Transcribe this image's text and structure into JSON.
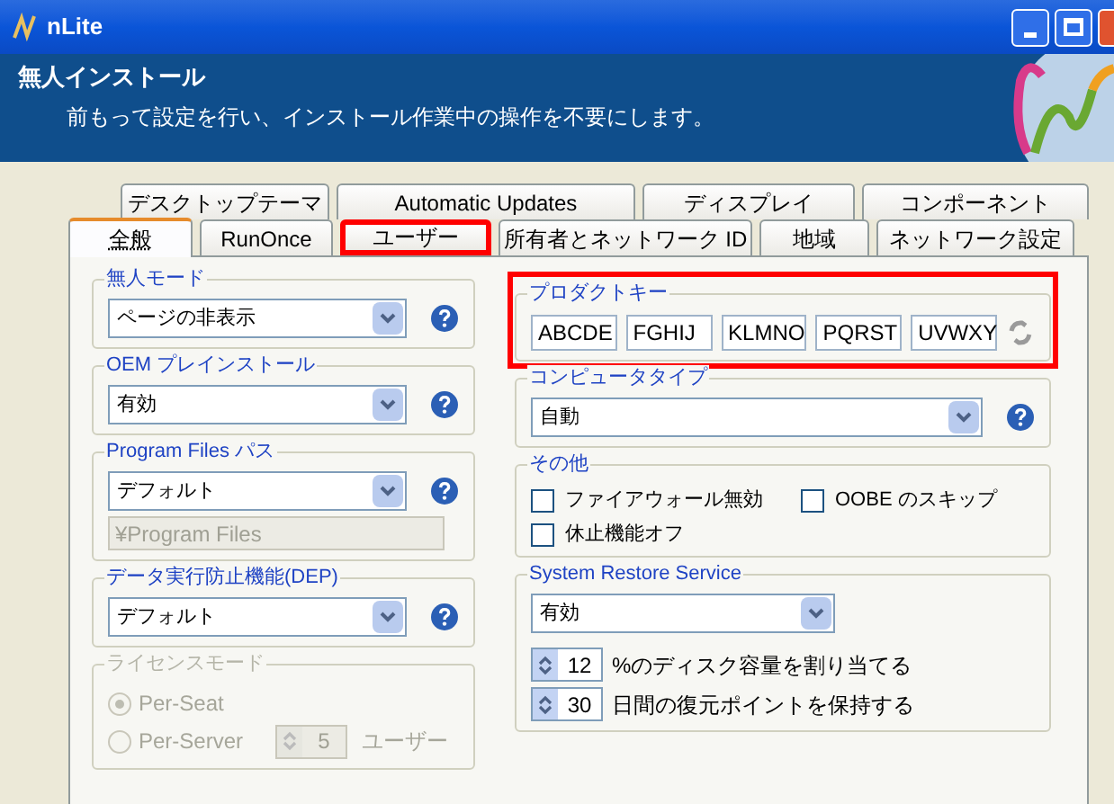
{
  "window": {
    "title": "nLite"
  },
  "header": {
    "title": "無人インストール",
    "subtitle": "前もって設定を行い、インストール作業中の操作を不要にします。"
  },
  "tab_rows": [
    [
      {
        "label": "デスクトップテーマ",
        "selected": false,
        "highlighted": false
      },
      {
        "label": "Automatic Updates",
        "selected": false,
        "highlighted": false
      },
      {
        "label": "ディスプレイ",
        "selected": false,
        "highlighted": false
      },
      {
        "label": "コンポーネント",
        "selected": false,
        "highlighted": false
      }
    ],
    [
      {
        "label": "全般",
        "selected": true,
        "highlighted": false
      },
      {
        "label": "RunOnce",
        "selected": false,
        "highlighted": false
      },
      {
        "label": "ユーザー",
        "selected": false,
        "highlighted": true
      },
      {
        "label": "所有者とネットワーク ID",
        "selected": false,
        "highlighted": false
      },
      {
        "label": "地域",
        "selected": false,
        "highlighted": false
      },
      {
        "label": "ネットワーク設定",
        "selected": false,
        "highlighted": false
      }
    ]
  ],
  "left_groups": [
    {
      "title": "無人モード",
      "disabled": false,
      "items": [
        {
          "kind": "combo",
          "value": "ページの非表示",
          "help": true
        }
      ]
    },
    {
      "title": "OEM プレインストール",
      "disabled": false,
      "items": [
        {
          "kind": "combo",
          "value": "有効",
          "help": true
        }
      ]
    },
    {
      "title": "Program Files パス",
      "disabled": false,
      "items": [
        {
          "kind": "combo",
          "value": "デフォルト",
          "help": true
        },
        {
          "kind": "field",
          "value": "¥Program Files",
          "disabled": true
        }
      ]
    },
    {
      "title": "データ実行防止機能(DEP)",
      "disabled": false,
      "items": [
        {
          "kind": "combo",
          "value": "デフォルト",
          "help": true
        }
      ]
    },
    {
      "title": "ライセンスモード",
      "disabled": true,
      "items": [
        {
          "kind": "radio",
          "label": "Per-Seat",
          "selected": true
        },
        {
          "kind": "radio",
          "label": "Per-Server",
          "selected": false,
          "spin": "5",
          "unit": "ユーザー"
        }
      ]
    }
  ],
  "product_key": {
    "title": "プロダクトキー",
    "highlighted": true,
    "parts": [
      "ABCDE",
      "FGHIJ",
      "KLMNO",
      "PQRST",
      "UVWXY"
    ]
  },
  "computer_type": {
    "title": "コンピュータタイプ",
    "value": "自動"
  },
  "misc": {
    "title": "その他",
    "options": [
      {
        "label": "ファイアウォール無効",
        "checked": false
      },
      {
        "label": "OOBE のスキップ",
        "checked": false
      },
      {
        "label": "休止機能オフ",
        "checked": false
      }
    ]
  },
  "system_restore": {
    "title": "System Restore Service",
    "value": "有効",
    "spins": [
      {
        "value": "12",
        "label": "%のディスク容量を割り当てる"
      },
      {
        "value": "30",
        "label": "日間の復元ポイントを保持する"
      }
    ]
  }
}
